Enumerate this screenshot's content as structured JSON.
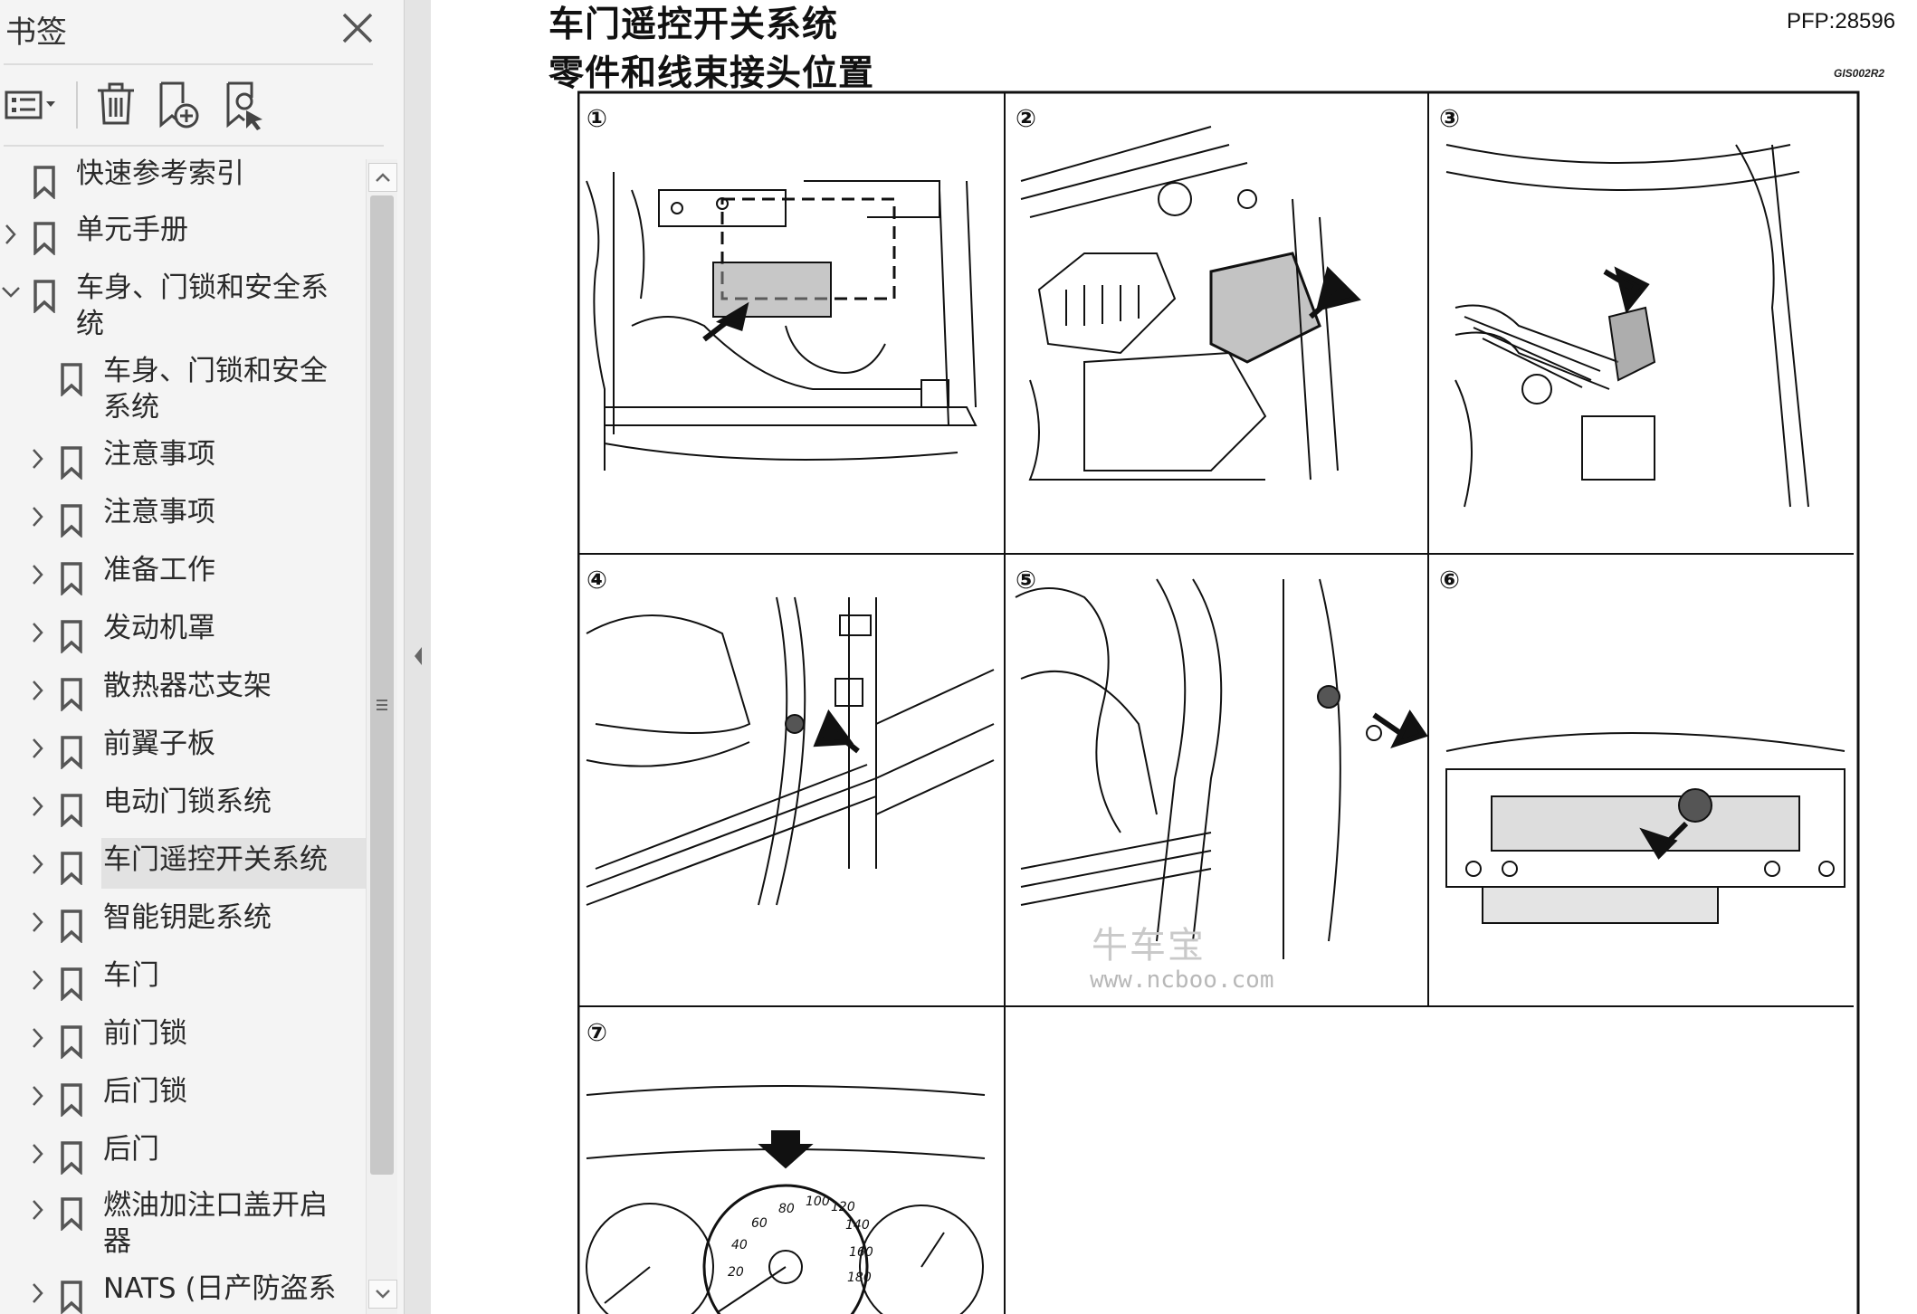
{
  "sidebar": {
    "title": "书签",
    "close_icon": "close-icon",
    "toolbar": [
      {
        "name": "options-menu-icon"
      },
      {
        "name": "delete-bookmark-icon"
      },
      {
        "name": "add-bookmark-icon"
      },
      {
        "name": "find-bookmark-icon"
      }
    ],
    "items": [
      {
        "label": "快速参考索引",
        "level": 0,
        "expand": "none"
      },
      {
        "label": "单元手册",
        "level": 0,
        "expand": "collapsed"
      },
      {
        "label": "车身、门锁和安全系统",
        "level": 0,
        "expand": "expanded"
      },
      {
        "label": "车身、门锁和安全系统",
        "level": 1,
        "expand": "none"
      },
      {
        "label": "注意事项",
        "level": 1,
        "expand": "collapsed"
      },
      {
        "label": "注意事项",
        "level": 1,
        "expand": "collapsed"
      },
      {
        "label": "准备工作",
        "level": 1,
        "expand": "collapsed"
      },
      {
        "label": "发动机罩",
        "level": 1,
        "expand": "collapsed"
      },
      {
        "label": "散热器芯支架",
        "level": 1,
        "expand": "collapsed"
      },
      {
        "label": "前翼子板",
        "level": 1,
        "expand": "collapsed"
      },
      {
        "label": "电动门锁系统",
        "level": 1,
        "expand": "collapsed"
      },
      {
        "label": "车门遥控开关系统",
        "level": 1,
        "expand": "collapsed",
        "selected": true
      },
      {
        "label": "智能钥匙系统",
        "level": 1,
        "expand": "collapsed"
      },
      {
        "label": "车门",
        "level": 1,
        "expand": "collapsed"
      },
      {
        "label": "前门锁",
        "level": 1,
        "expand": "collapsed"
      },
      {
        "label": "后门锁",
        "level": 1,
        "expand": "collapsed"
      },
      {
        "label": "后门",
        "level": 1,
        "expand": "collapsed"
      },
      {
        "label": "燃油加注口盖开启器",
        "level": 1,
        "expand": "collapsed"
      },
      {
        "label": "NATS (日产防盗系",
        "level": 1,
        "expand": "collapsed"
      }
    ]
  },
  "document": {
    "title": "车门遥控开关系统",
    "subtitle": "零件和线束接头位置",
    "page_code": "PFP:28596",
    "figure_code": "GIS002R2",
    "panels": [
      "①",
      "②",
      "③",
      "④",
      "⑤",
      "⑥",
      "⑦"
    ],
    "gauge_labels": [
      "60",
      "80",
      "100",
      "120",
      "140",
      "160",
      "180",
      "40",
      "20"
    ],
    "watermark_cn": "牛车宝",
    "watermark_url": "www.ncboo.com"
  },
  "colors": {
    "pane_bg": "#f4f4f4",
    "selection": "#e2e2e2",
    "line_art": "#111111"
  }
}
